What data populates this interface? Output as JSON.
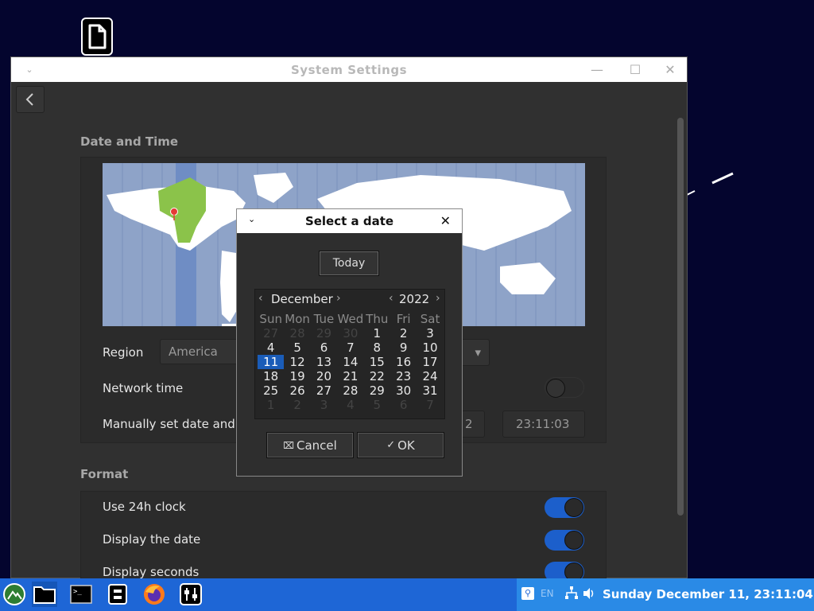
{
  "window": {
    "title": "System Settings",
    "date_time_section": "Date and Time",
    "region_label": "Region",
    "region_value": "America",
    "network_time_label": "Network time",
    "manual_label": "Manually set date and",
    "manual_date_partial": "2",
    "manual_time": "23:11:03",
    "format_section": "Format",
    "format_rows": [
      {
        "label": "Use 24h clock",
        "on": true
      },
      {
        "label": "Display the date",
        "on": true
      },
      {
        "label": "Display seconds",
        "on": true
      }
    ]
  },
  "dialog": {
    "title": "Select a date",
    "today_label": "Today",
    "month": "December",
    "year": "2022",
    "weekdays": [
      "Sun",
      "Mon",
      "Tue",
      "Wed",
      "Thu",
      "Fri",
      "Sat"
    ],
    "weeks": [
      [
        "27",
        "28",
        "29",
        "30",
        "1",
        "2",
        "3"
      ],
      [
        "4",
        "5",
        "6",
        "7",
        "8",
        "9",
        "10"
      ],
      [
        "11",
        "12",
        "13",
        "14",
        "15",
        "16",
        "17"
      ],
      [
        "18",
        "19",
        "20",
        "21",
        "22",
        "23",
        "24"
      ],
      [
        "25",
        "26",
        "27",
        "28",
        "29",
        "30",
        "31"
      ],
      [
        "1",
        "2",
        "3",
        "4",
        "5",
        "6",
        "7"
      ]
    ],
    "selected_day": "11",
    "cancel_label": "Cancel",
    "ok_label": "OK"
  },
  "taskbar": {
    "keyboard_layout": "EN",
    "clock": "Sunday December 11, 23:11:04",
    "apps": [
      "start-menu",
      "file-manager",
      "terminal",
      "archive-manager",
      "firefox",
      "system-settings"
    ]
  },
  "colors": {
    "accent": "#1a5cb8",
    "taskbar": "#1e66d6",
    "tray": "#2a8ae6",
    "desktop": "#04052e"
  }
}
